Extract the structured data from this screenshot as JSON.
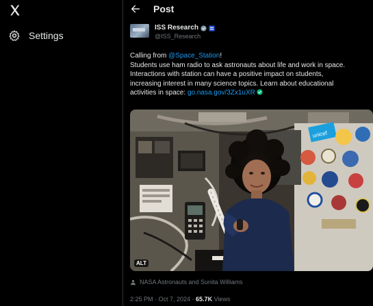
{
  "sidebar": {
    "logo_icon": "x-logo-icon",
    "settings_label": "Settings",
    "settings_icon": "gear-icon"
  },
  "header": {
    "back_icon": "arrow-left-icon",
    "title": "Post"
  },
  "post": {
    "author": {
      "name": "ISS Research",
      "handle": "@ISS_Research",
      "badges": [
        "verified-icon",
        "government-badge-icon"
      ]
    },
    "text": {
      "intro": "Calling from ",
      "mention": "@Space_Station",
      "mention_suffix": "!",
      "line2": "Students use ham radio to ask astronauts about life and work in space.",
      "line3": "Interactions with station can have a positive impact on students,",
      "line4": "increasing interest in many science topics. Learn about educational",
      "line5_prefix": "activities in space: ",
      "link": "go.nasa.gov/3Zx1uXR"
    },
    "media": {
      "alt_label": "ALT",
      "image_sign": "unicef"
    },
    "tagged": "NASA Astronauts and Sunita Williams",
    "time": "2:25 PM · Oct 7, 2024 · ",
    "views_count": "65.7K",
    "views_label": " Views"
  },
  "colors": {
    "background": "#000000",
    "text": "#e7e9ea",
    "muted": "#71767b",
    "link": "#1d9bf0",
    "border": "#2f3336"
  }
}
